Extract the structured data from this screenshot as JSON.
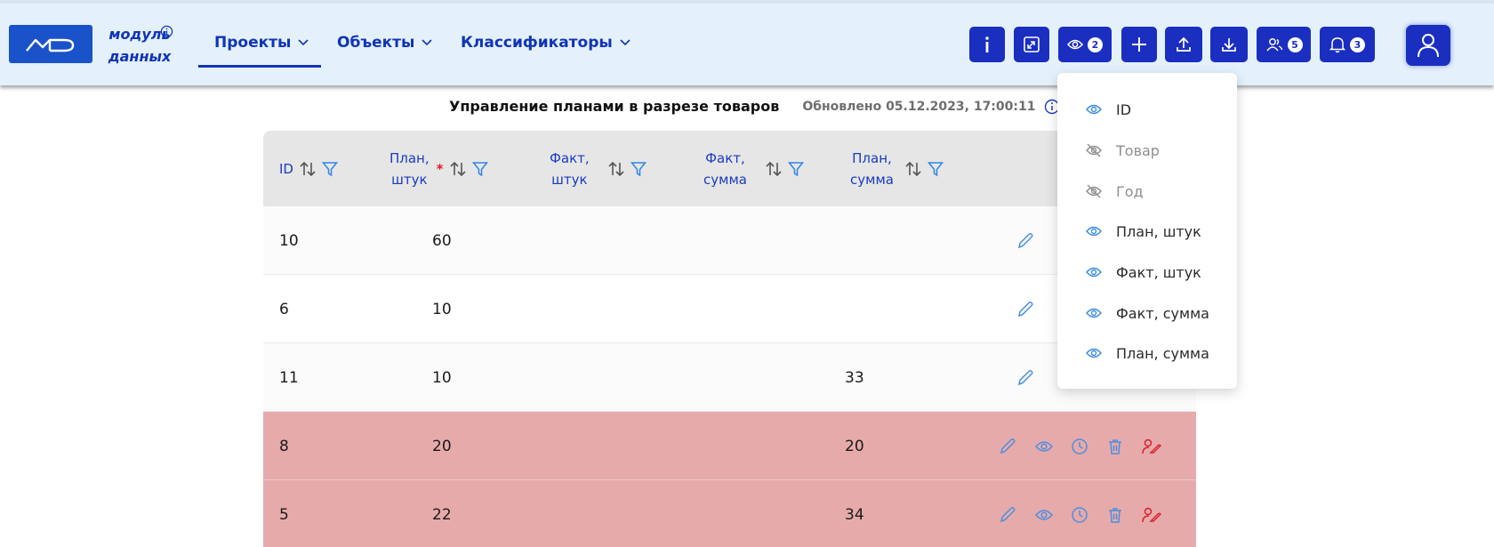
{
  "header": {
    "logo_text": "МД",
    "brand": {
      "line1": "модуль",
      "line2": "данных"
    },
    "nav": [
      {
        "label": "Проекты",
        "active": true
      },
      {
        "label": "Объекты",
        "active": false
      },
      {
        "label": "Классификаторы",
        "active": false
      }
    ],
    "toolbar": {
      "visibility_count": "2",
      "users_count": "5",
      "notifications_count": "3"
    }
  },
  "main": {
    "title": "Управление планами в разрезе товаров",
    "updated": "Обновлено 05.12.2023, 17:00:11"
  },
  "table": {
    "columns": [
      {
        "line1": "ID",
        "line2": "",
        "required": false
      },
      {
        "line1": "План,",
        "line2": "штук",
        "required": true
      },
      {
        "line1": "Факт,",
        "line2": "штук",
        "required": false
      },
      {
        "line1": "Факт,",
        "line2": "сумма",
        "required": false
      },
      {
        "line1": "План,",
        "line2": "сумма",
        "required": false
      }
    ],
    "rows": [
      {
        "id": "10",
        "plan_qty": "60",
        "fact_qty": "",
        "fact_sum": "",
        "plan_sum": "",
        "status": "normal"
      },
      {
        "id": "6",
        "plan_qty": "10",
        "fact_qty": "",
        "fact_sum": "",
        "plan_sum": "",
        "status": "normal"
      },
      {
        "id": "11",
        "plan_qty": "10",
        "fact_qty": "",
        "fact_sum": "",
        "plan_sum": "33",
        "status": "normal"
      },
      {
        "id": "8",
        "plan_qty": "20",
        "fact_qty": "",
        "fact_sum": "",
        "plan_sum": "20",
        "status": "error"
      },
      {
        "id": "5",
        "plan_qty": "22",
        "fact_qty": "",
        "fact_sum": "",
        "plan_sum": "34",
        "status": "error"
      }
    ]
  },
  "column_visibility_menu": {
    "items": [
      {
        "label": "ID",
        "visible": true
      },
      {
        "label": "Товар",
        "visible": false
      },
      {
        "label": "Год",
        "visible": false
      },
      {
        "label": "План, штук",
        "visible": true
      },
      {
        "label": "Факт, штук",
        "visible": true
      },
      {
        "label": "Факт, сумма",
        "visible": true
      },
      {
        "label": "План, сумма",
        "visible": true
      }
    ]
  },
  "colors": {
    "brand_blue": "#1a2fc0",
    "nav_text": "#1034b7",
    "header_bg": "#e4f1fb",
    "error_row": "#e7aaaa",
    "action_blue": "#4a8fe0",
    "action_red": "#d6202f"
  }
}
